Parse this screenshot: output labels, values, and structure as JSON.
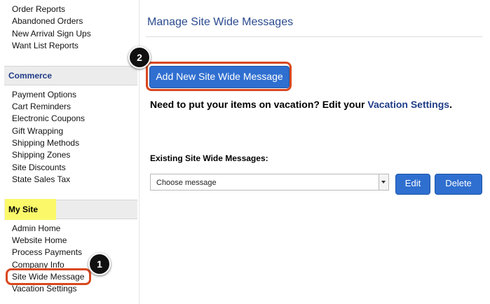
{
  "sidebar": {
    "top_items": [
      "Order Reports",
      "Abandoned Orders",
      "New Arrival Sign Ups",
      "Want List Reports"
    ],
    "commerce": {
      "heading": "Commerce",
      "items": [
        "Payment Options",
        "Cart Reminders",
        "Electronic Coupons",
        "Gift Wrapping",
        "Shipping Methods",
        "Shipping Zones",
        "Site Discounts",
        "State Sales Tax"
      ]
    },
    "mysite": {
      "heading": "My Site",
      "items": [
        "Admin Home",
        "Website Home",
        "Process Payments",
        "Company Info",
        "Site Wide Message",
        "Vacation Settings"
      ]
    }
  },
  "main": {
    "page_title": "Manage Site Wide Messages",
    "add_button_label": "Add New Site Wide Message",
    "vacation_prefix": "Need to put your items on vacation? Edit your ",
    "vacation_link": "Vacation Settings",
    "vacation_suffix": ".",
    "existing_label": "Existing Site Wide Messages:",
    "select_value": "Choose message",
    "edit_label": "Edit",
    "delete_label": "Delete"
  },
  "callouts": {
    "one": "1",
    "two": "2"
  },
  "colors": {
    "accent_blue": "#2f6fd0",
    "highlight_red": "#d9481f",
    "highlight_yellow": "#fbf96a",
    "link_blue": "#1f3c87"
  }
}
